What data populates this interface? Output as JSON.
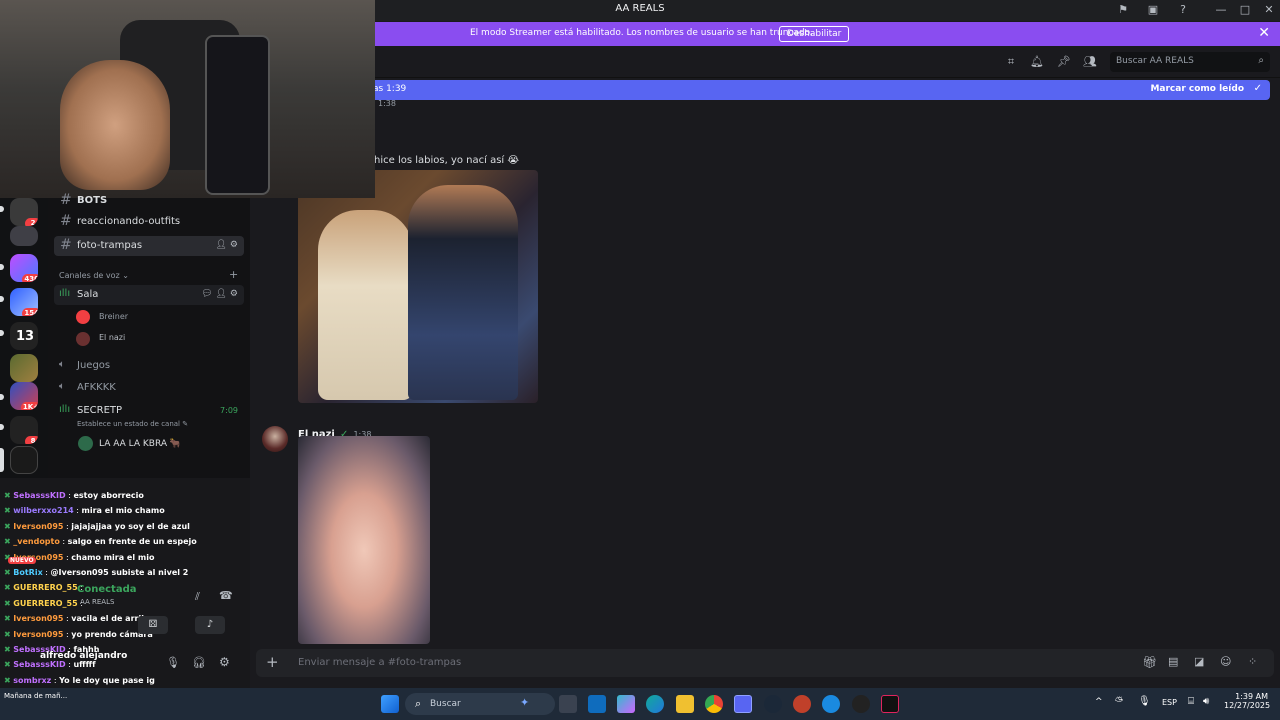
{
  "app": {
    "title": "AA REALS"
  },
  "banner": {
    "text": "El modo Streamer está habilitado. Los nombres de usuario se han truncado.",
    "button": "Deshabilitar"
  },
  "header": {
    "search_placeholder": "Buscar AA REALS"
  },
  "new_messages": {
    "text": "as 1:39",
    "mark_read": "Marcar como leído"
  },
  "chat": {
    "partial_time": "1:38",
    "partial_message": "hice los labios, yo nací así",
    "emoji": "😭",
    "message2": {
      "author": "El nazi",
      "time": "1:38"
    }
  },
  "servers": [
    {
      "badge": "2"
    },
    {
      "badge": ""
    },
    {
      "badge": "430"
    },
    {
      "badge": "154"
    },
    {
      "badge": ""
    },
    {
      "badge": ""
    },
    {
      "badge": "1K+"
    },
    {
      "badge": "8"
    },
    {
      "badge": ""
    }
  ],
  "channels": {
    "text": [
      {
        "name": "BOTS"
      },
      {
        "name": "reaccionando-outfits"
      },
      {
        "name": "foto-trampas"
      }
    ],
    "voice_header": "Canales de voz",
    "voice": [
      {
        "name": "Sala",
        "members": [
          "Breiner",
          "El nazi"
        ]
      },
      {
        "name": "Juegos"
      },
      {
        "name": "AFKKKK"
      },
      {
        "name": "SECRETP",
        "time": "7:09",
        "status": "Establece un estado de canal",
        "members": [
          "LA AA LA KBRA 🐂"
        ]
      }
    ]
  },
  "twitch": [
    {
      "user": "SebasssKID",
      "msg": "estoy aborrecio",
      "color": "#c070ff"
    },
    {
      "user": "wilberxxo214",
      "msg": "mira el mio chamo",
      "color": "#9b7bff"
    },
    {
      "user": "Iverson095",
      "msg": "jajajajjaa yo soy el de azul",
      "color": "#ff9b3d"
    },
    {
      "user": "_vendopto",
      "msg": "salgo en frente de un espejo",
      "color": "#ff9b3d"
    },
    {
      "user": "Iverson095",
      "msg": "chamo mira el mio",
      "color": "#ff9b3d"
    },
    {
      "user": "BotRix",
      "msg": "@Iverson095 subiste al nivel 2",
      "color": "#4ecbff"
    },
    {
      "user": "GUERRERO_55",
      "msg": "",
      "color": "#ffd24d"
    },
    {
      "user": "GUERRERO_55",
      "msg": "",
      "color": "#ffd24d"
    },
    {
      "user": "Iverson095",
      "msg": "vacila el de arriba",
      "color": "#ff9b3d"
    },
    {
      "user": "Iverson095",
      "msg": "yo prendo cámara",
      "color": "#ff9b3d"
    },
    {
      "user": "SebasssKID",
      "msg": "fahhh",
      "color": "#c070ff"
    },
    {
      "user": "SebasssKID",
      "msg": "ufffff",
      "color": "#c070ff"
    },
    {
      "user": "sombrxz",
      "msg": "Yo le doy que pase ig",
      "color": "#c070ff"
    }
  ],
  "voice_panel": {
    "status": "Conectada",
    "server": "AA REALS"
  },
  "user_panel": {
    "name": "alfredo alejandro",
    "new_tag": "NUEVO"
  },
  "composer": {
    "placeholder": "Enviar mensaje a #foto-trampas"
  },
  "taskbar": {
    "search": "Buscar",
    "lang": "ESP",
    "time": "1:39 AM",
    "date": "12/27/2025",
    "widget_text": "Mañana de mañ..."
  }
}
